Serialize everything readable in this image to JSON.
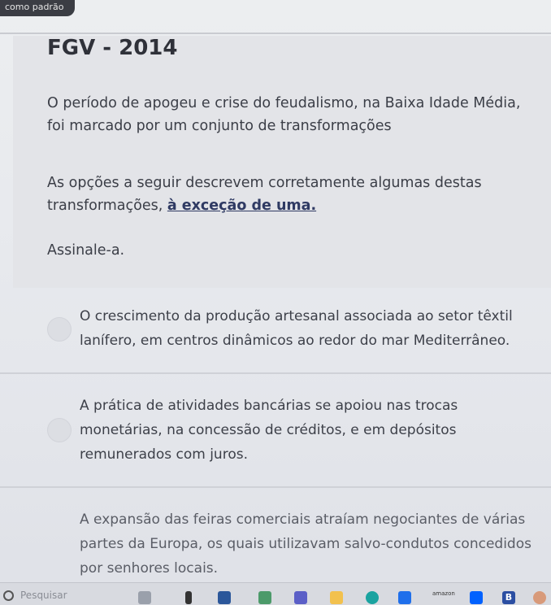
{
  "top_tag": "como padrão",
  "question": {
    "title": "FGV - 2014",
    "paragraph1": "O período de apogeu e crise do feudalismo, na Baixa Idade Média, foi marcado por um conjunto de transformações",
    "paragraph2_prefix": "As opções a seguir descrevem corretamente algumas destas transformações,",
    "paragraph2_emphasis": "à exceção de uma.",
    "paragraph3": "Assinale-a."
  },
  "options": [
    {
      "text": "O crescimento da produção artesanal associada ao setor têxtil lanífero, em centros dinâmicos ao redor do mar Mediterrâneo."
    },
    {
      "text": "A prática de atividades bancárias se apoiou nas trocas monetárias, na concessão de créditos, e em depósitos remunerados com juros."
    },
    {
      "text": "A expansão das feiras comerciais atraíam negociantes de várias partes da Europa, os quais utilizavam salvo-condutos concedidos por senhores locais."
    }
  ],
  "taskbar": {
    "search_label": "Pesquisar",
    "amazon_label": "amazon",
    "b_label": "B",
    "icons": [
      "pinned-app-icon",
      "file-icon",
      "word-icon",
      "photos-icon",
      "teams-icon",
      "folder-icon",
      "edge-icon",
      "store-icon",
      "amazon-icon",
      "dropbox-icon",
      "b-app-icon",
      "browser-icon"
    ],
    "colors": {
      "word": "#2b579a",
      "teams": "#5b5fc7",
      "folder": "#f2c14e",
      "edge": "#1aa3a0",
      "store": "#1f6feb",
      "dropbox": "#0061fe",
      "b_app": "#2b4ea2"
    }
  }
}
